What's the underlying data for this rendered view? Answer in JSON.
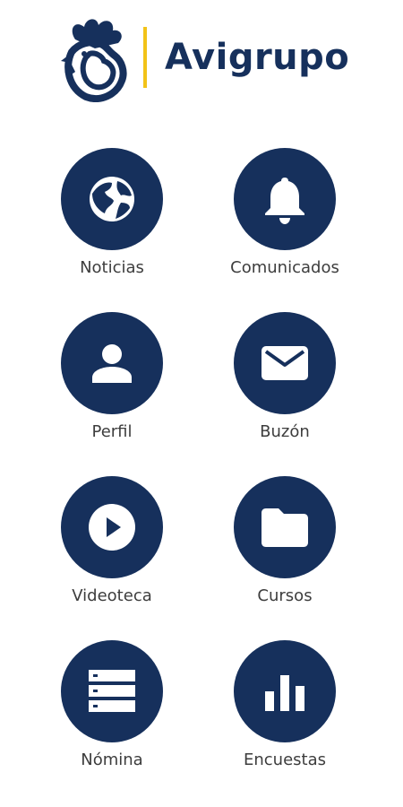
{
  "brand": {
    "name": "Avigrupo",
    "logo_icon": "rooster-logo-icon",
    "primary_color": "#16305c",
    "accent_color": "#f2c318"
  },
  "menu": {
    "items": [
      {
        "label": "Noticias",
        "icon": "globe-icon"
      },
      {
        "label": "Comunicados",
        "icon": "bell-icon"
      },
      {
        "label": "Perfil",
        "icon": "person-icon"
      },
      {
        "label": "Buzón",
        "icon": "mail-icon"
      },
      {
        "label": "Videoteca",
        "icon": "play-circle-icon"
      },
      {
        "label": "Cursos",
        "icon": "folder-icon"
      },
      {
        "label": "Nómina",
        "icon": "list-icon"
      },
      {
        "label": "Encuestas",
        "icon": "bar-chart-icon"
      }
    ]
  }
}
